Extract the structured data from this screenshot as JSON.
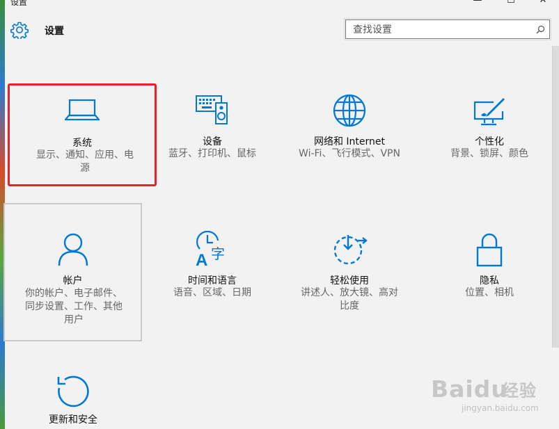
{
  "window": {
    "title": "设置",
    "minimize_glyph": "—",
    "maximize_glyph": "☐",
    "close_glyph": "✕"
  },
  "header": {
    "title": "设置",
    "icon": "gear-icon"
  },
  "search": {
    "placeholder": "查找设置",
    "icon": "search-icon"
  },
  "tiles": [
    {
      "id": "system",
      "name": "系统",
      "desc_line1": "显示、通知、应用、电",
      "desc_line2": "源",
      "icon": "laptop-icon",
      "selected": true
    },
    {
      "id": "devices",
      "name": "设备",
      "desc_line1": "蓝牙、打印机、鼠标",
      "icon": "devices-icon"
    },
    {
      "id": "network",
      "name": "网络和 Internet",
      "desc_line1": "Wi-Fi、飞行模式、VPN",
      "icon": "globe-icon"
    },
    {
      "id": "personalization",
      "name": "个性化",
      "desc_line1": "背景、锁屏、颜色",
      "icon": "paintbrush-icon"
    },
    {
      "id": "accounts",
      "name": "帐户",
      "desc_line1": "你的帐户、电子邮件、",
      "desc_line2": "同步设置、工作、其他",
      "desc_line3": "用户",
      "icon": "person-icon",
      "hovered": true
    },
    {
      "id": "time",
      "name": "时间和语言",
      "desc_line1": "语音、区域、日期",
      "icon": "time-language-icon"
    },
    {
      "id": "ease",
      "name": "轻松使用",
      "desc_line1": "讲述人、放大镜、高对",
      "desc_line2": "比度",
      "icon": "ease-of-access-icon"
    },
    {
      "id": "privacy",
      "name": "隐私",
      "desc_line1": "位置、相机",
      "icon": "lock-icon"
    },
    {
      "id": "update",
      "name": "更新和安全",
      "icon": "refresh-icon"
    }
  ],
  "colors": {
    "accent": "#0078d7",
    "highlight_border": "#e8202a",
    "background": "#f2f2f2"
  },
  "watermark": {
    "brand": "Baidu",
    "brand_cn": "经验",
    "url": "jingyan.baidu.com"
  }
}
